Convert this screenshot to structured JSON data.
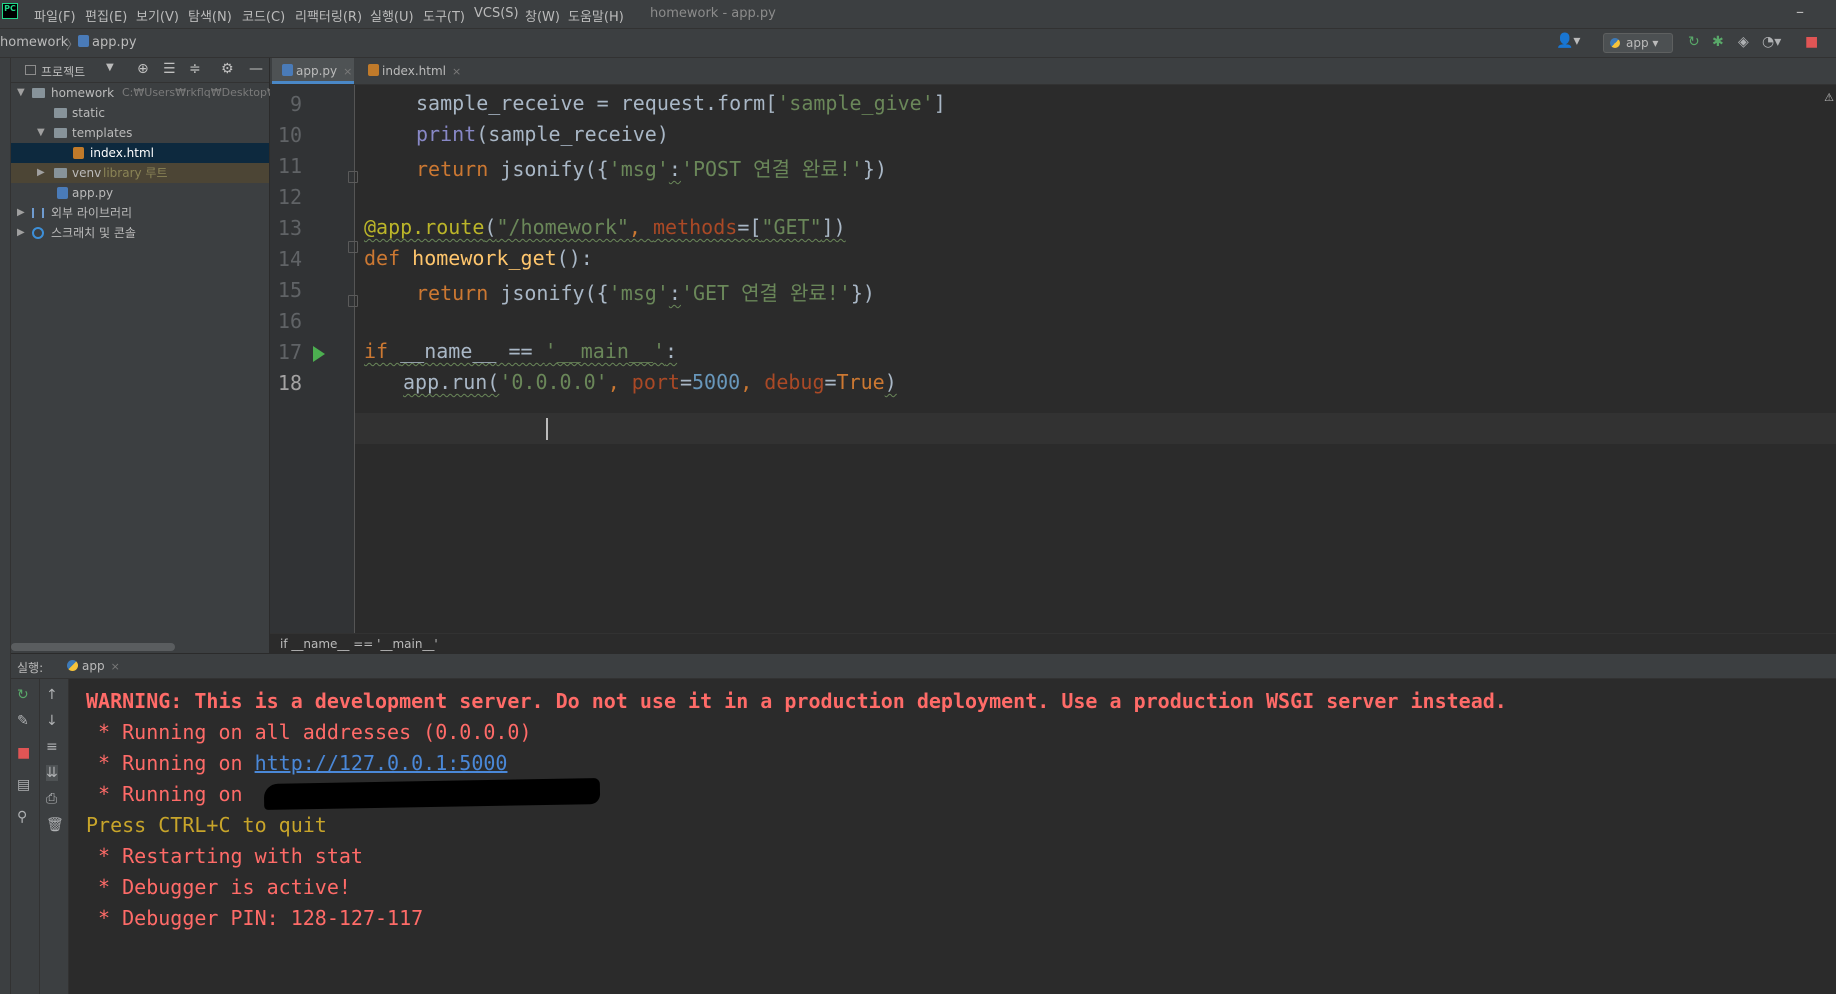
{
  "menu": {
    "logo": "PC",
    "items": [
      "파일(F)",
      "편집(E)",
      "보기(V)",
      "탐색(N)",
      "코드(C)",
      "리팩터링(R)",
      "실행(U)",
      "도구(T)",
      "VCS(S)",
      "창(W)",
      "도움말(H)"
    ],
    "window_title": "homework - app.py"
  },
  "nav": {
    "root": "homework",
    "separator": "〉",
    "file": "app.py",
    "run_config": "app"
  },
  "project": {
    "title": "프로젝트",
    "tree": {
      "root_name": "homework",
      "root_path": "C:₩Users₩rkflq₩Desktop₩s",
      "static": "static",
      "templates": "templates",
      "index": "index.html",
      "venv": "venv",
      "venv_tag": "library 루트",
      "app": "app.py",
      "external": "외부 라이브러리",
      "scratch": "스크래치 및 콘솔"
    }
  },
  "editor": {
    "tabs": [
      {
        "label": "app.py"
      },
      {
        "label": "index.html"
      }
    ],
    "line_numbers": [
      "9",
      "10",
      "11",
      "12",
      "13",
      "14",
      "15",
      "16",
      "17",
      "18"
    ],
    "code": {
      "l9": {
        "a": "sample_receive = request.form[",
        "b": "'sample_give'",
        "c": "]"
      },
      "l10": {
        "fn": "print",
        "rest": "(sample_receive)"
      },
      "l11": {
        "kw": "return ",
        "a": "jsonify({",
        "k": "'msg'",
        "colon": ":",
        "v": "'POST 연결 완료!'",
        "end": "})"
      },
      "l13": {
        "deco": "@app.route",
        "p1": "(",
        "path": "\"/homework\"",
        "comma": ", ",
        "param": "methods",
        "eq": "=[",
        "get": "\"GET\"",
        "end": "])"
      },
      "l14": {
        "kw": "def ",
        "fn": "homework_get",
        "end": "():"
      },
      "l15": {
        "kw": "return ",
        "a": "jsonify({",
        "k": "'msg'",
        "colon": ":",
        "v": "'GET 연결 완료!'",
        "end": "})"
      },
      "l17": {
        "kw": "if ",
        "name": "__name__",
        "op": " == ",
        "main": "'__main__'",
        "end": ":"
      },
      "l18": {
        "a": "app.run(",
        "host_a": "'0.",
        "host_b": "0.0.0'",
        "comma1": ", ",
        "p1": "port",
        "eq1": "=",
        "port": "5000",
        "comma2": ", ",
        "p2": "debug",
        "eq2": "=",
        "dbg": "True",
        "end": ")"
      }
    },
    "breadcrumb": "if __name__ == '__main__'"
  },
  "run": {
    "label": "실행:",
    "tab": "app",
    "console": {
      "warning": "WARNING: This is a development server. Do not use it in a production deployment. Use a production WSGI server instead.",
      "l1": " * Running on all addresses (0.0.0.0)",
      "l2_prefix": " * Running on ",
      "l2_link": "http://127.0.0.1:5000",
      "l3_prefix": " * Running on ",
      "quit": "Press CTRL+C to quit",
      "l4": " * Restarting with stat",
      "l5": " * Debugger is active!",
      "l6": " * Debugger PIN: 128-127-117"
    }
  },
  "colors": {
    "keyword": "#cc7832",
    "string": "#6a8759",
    "function": "#ffc66d",
    "number": "#6897bb",
    "console_error": "#ff6b68",
    "console_quit": "#c8a52a"
  }
}
